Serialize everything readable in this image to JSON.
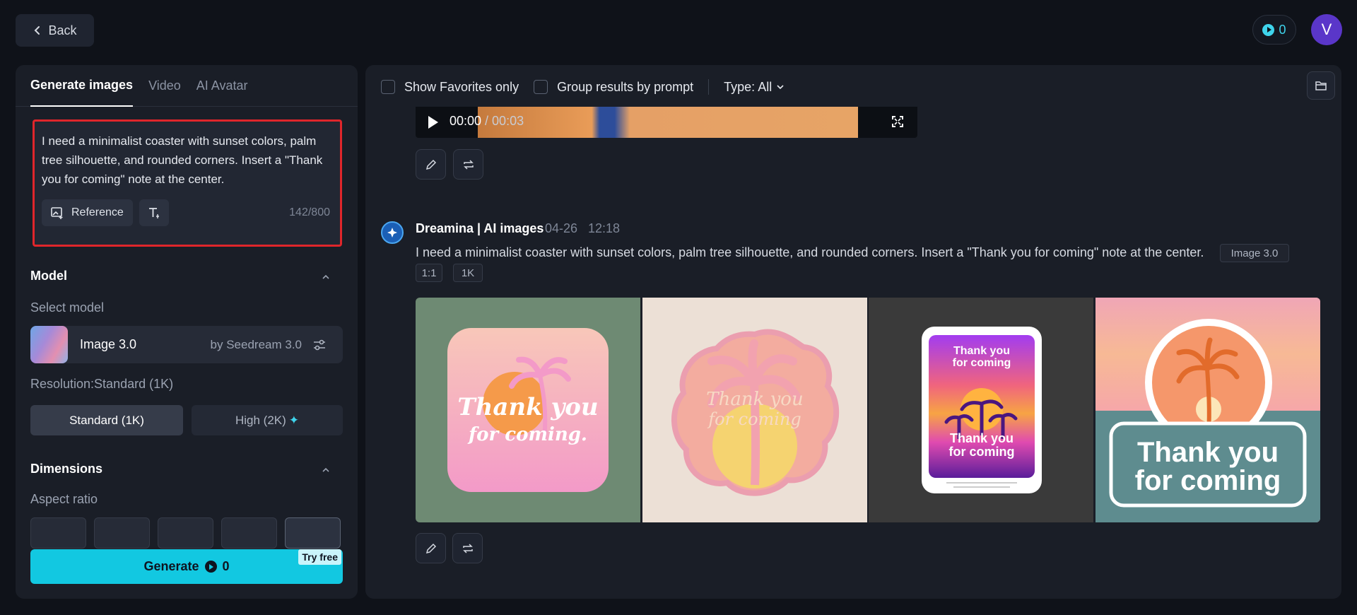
{
  "header": {
    "back_label": "Back",
    "credits": "0",
    "avatar_initial": "V"
  },
  "left_panel": {
    "tabs": [
      {
        "label": "Generate images",
        "active": true
      },
      {
        "label": "Video",
        "active": false
      },
      {
        "label": "AI Avatar",
        "active": false
      }
    ],
    "prompt": {
      "text": "I need a minimalist coaster with sunset colors, palm tree silhouette, and rounded corners. Insert a \"Thank you for coming\" note at the center.",
      "reference_label": "Reference",
      "counter": "142/800"
    },
    "model": {
      "section_title": "Model",
      "select_label": "Select model",
      "name": "Image 3.0",
      "by": "by Seedream 3.0"
    },
    "resolution": {
      "label": "Resolution:Standard (1K)",
      "standard_label": "Standard (1K)",
      "high_label": "High (2K)"
    },
    "dimensions": {
      "section_title": "Dimensions",
      "aspect_label": "Aspect ratio"
    },
    "generate": {
      "label": "Generate",
      "cost": "0",
      "badge": "Try free"
    }
  },
  "right_panel": {
    "filters": {
      "favorites_label": "Show Favorites only",
      "group_label": "Group results by prompt",
      "type_label": "Type: All"
    },
    "video": {
      "time_current": "00:00",
      "time_sep": " / 00:03"
    },
    "message": {
      "author": "Dreamina | AI images",
      "date": "04-26",
      "time": "12:18",
      "prompt": "I need a minimalist coaster with sunset colors, palm tree silhouette, and rounded corners. Insert a \"Thank you for coming\" note at the center.",
      "chips": [
        "Image 3.0",
        "1:1",
        "1K"
      ]
    },
    "images": [
      {
        "text_line1": "Thank you",
        "text_line2": "for coming."
      },
      {
        "text_line1": "Thank you",
        "text_line2": "for coming"
      },
      {
        "text_line1": "Thank you",
        "text_line2": "for coming",
        "text_line3": "Thank you",
        "text_line4": "for coming"
      },
      {
        "text_line1": "Thank you",
        "text_line2": "for coming"
      }
    ]
  },
  "colors": {
    "accent": "#12c8e1",
    "highlight_border": "#e0262b",
    "avatar": "#5a36c9"
  }
}
